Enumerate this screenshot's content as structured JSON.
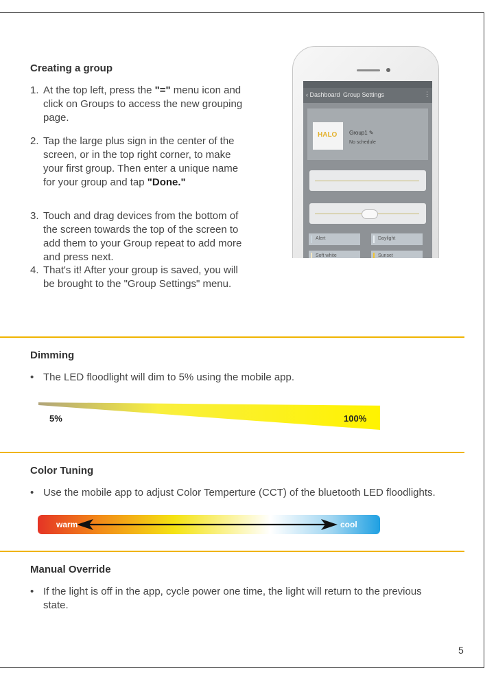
{
  "sections": {
    "group": {
      "heading": "Creating a group",
      "steps": [
        {
          "num": "1.",
          "pre": "At the top left, press the ",
          "bold": "\"=\"",
          "post": " menu icon and click on Groups to access the new grouping page."
        },
        {
          "num": "2.",
          "pre": "Tap the large plus sign in the center of the screen, or in the top right corner, to make your first group. Then enter a unique name for your group and tap ",
          "bold": "\"Done.\"",
          "post": ""
        },
        {
          "num": "3.",
          "text": "Touch and drag devices from the bottom of the screen towards the top of the screen to add them to your Group repeat to add more and press next."
        },
        {
          "num": "4.",
          "text": "That's it! After your group is saved, you will be brought to the \"Group Settings\" menu."
        }
      ]
    },
    "dimming": {
      "heading": "Dimming",
      "bullet": "The LED floodlight will dim to 5% using the mobile app.",
      "min_label": "5%",
      "max_label": "100%"
    },
    "color_tuning": {
      "heading": "Color Tuning",
      "bullet": "Use the mobile app to adjust Color Temperture (CCT) of the bluetooth LED floodlights.",
      "warm_label": "warm",
      "cool_label": "cool"
    },
    "manual_override": {
      "heading": "Manual Override",
      "bullet": "If the light is off in the app, cycle power one time, the light will return to the previous state."
    }
  },
  "phone": {
    "back_label": "Dashboard",
    "screen_title": "Group Settings",
    "logo": "HALO",
    "group_name": "Group1",
    "schedule": "No schedule",
    "presets": [
      {
        "label": "Alert",
        "color": "#c9d4dc"
      },
      {
        "label": "Daylight",
        "color": "#e8eef2"
      },
      {
        "label": "Soft white",
        "color": "#f3e7c2"
      },
      {
        "label": "Sunset",
        "color": "#f0c431"
      }
    ]
  },
  "page_number": "5",
  "colors": {
    "accent_rule": "#f0b400",
    "dim_gradient_end": "#fff300",
    "warm": "#e53425",
    "cool": "#1fa0e2"
  }
}
